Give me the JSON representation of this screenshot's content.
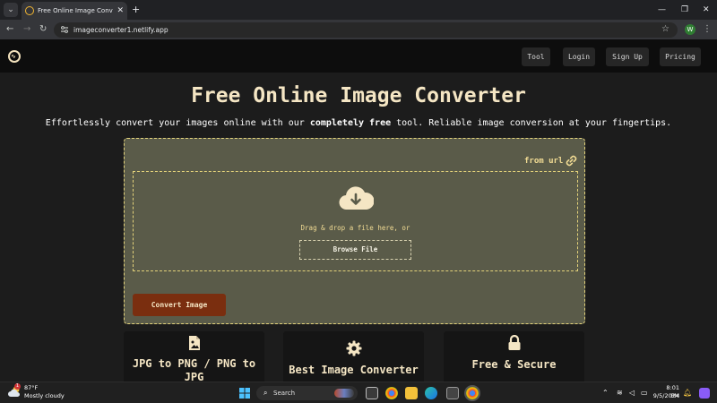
{
  "browser": {
    "tab_title": "Free Online Image Converter |",
    "tab_close": "✕",
    "new_tab": "+",
    "url": "imageconverter1.netlify.app",
    "profile_initial": "W"
  },
  "site_nav": {
    "links": [
      "Tool",
      "Login",
      "Sign Up",
      "Pricing"
    ]
  },
  "hero": {
    "title": "Free Online Image Converter",
    "subtitle_pre": "Effortlessly convert your images online with our ",
    "subtitle_bold": "completely free",
    "subtitle_post": " tool. Reliable image conversion at your fingertips."
  },
  "upload": {
    "from_url_label": "from url",
    "drag_text": "Drag & drop a file here, or",
    "browse_label": "Browse File",
    "convert_label": "Convert Image"
  },
  "features": [
    {
      "title_line1": "JPG to PNG / PNG to",
      "title_line2": "JPG",
      "icon": "image-file-icon"
    },
    {
      "title_line1": "Best Image Converter",
      "icon": "gear-icon"
    },
    {
      "title_line1": "Free & Secure",
      "icon": "lock-icon"
    }
  ],
  "taskbar": {
    "weather_temp": "87°F",
    "weather_condition": "Mostly cloudy",
    "weather_badge": "1",
    "search_label": "Search",
    "time": "8:01 PM",
    "date": "9/5/2024"
  },
  "colors": {
    "accent": "#f5e6c4",
    "card_bg": "#5a5b49",
    "convert_button": "#7a2e0f",
    "dash": "#e3d27a"
  }
}
